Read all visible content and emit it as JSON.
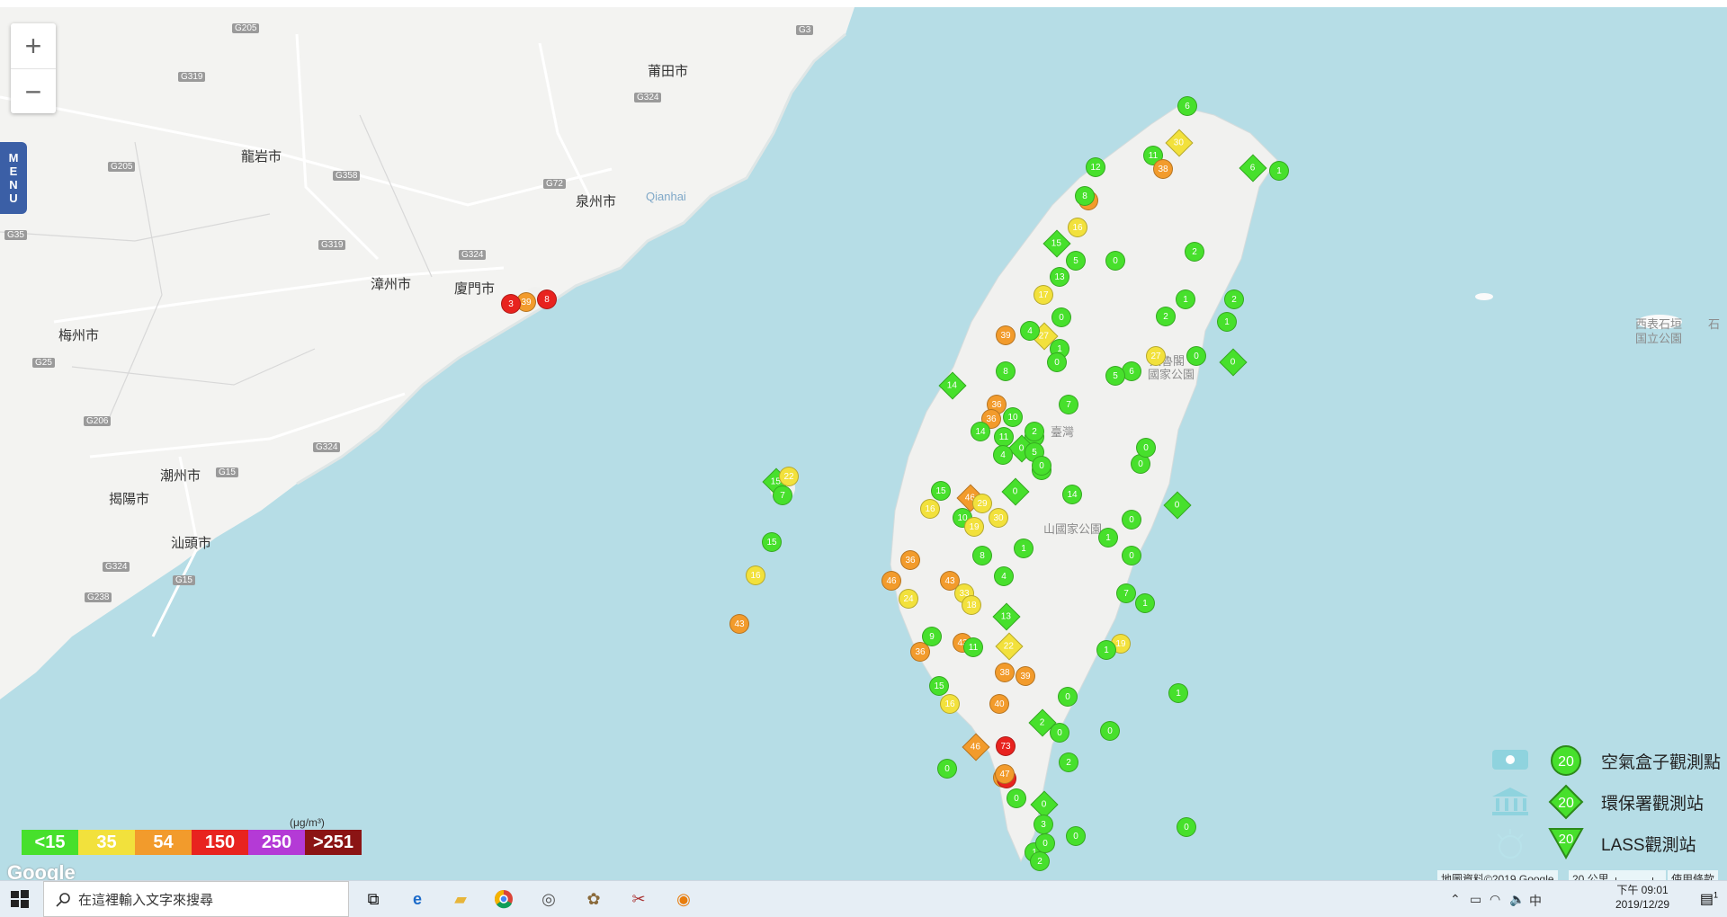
{
  "map": {
    "zoom_in": "+",
    "zoom_out": "−",
    "menu_label": [
      "M",
      "E",
      "N",
      "U"
    ],
    "google_logo": "Google",
    "copyright": "地圖資料©2019 Google",
    "scale_text": "20 公里",
    "terms": "使用條款",
    "unit": "(μg/m³)",
    "place_labels": [
      {
        "text": "莆田市"
      },
      {
        "text": "龍岩市"
      },
      {
        "text": "泉州市"
      },
      {
        "text": "Qianhai"
      },
      {
        "text": "漳州市"
      },
      {
        "text": "廈門市"
      },
      {
        "text": "梅州市"
      },
      {
        "text": "潮州市"
      },
      {
        "text": "揭陽市"
      },
      {
        "text": "汕頭市"
      },
      {
        "text": "太魯閣"
      },
      {
        "text": "國家公園"
      },
      {
        "text": "山國家公園"
      },
      {
        "text": "臺灣"
      },
      {
        "text": "西表石垣"
      },
      {
        "text": "国立公園"
      },
      {
        "text": "石"
      }
    ],
    "road_labels": [
      "G205",
      "G3",
      "G319",
      "G324",
      "G205",
      "G358",
      "G72",
      "G319",
      "G324",
      "G35",
      "G25",
      "G206",
      "G15",
      "G324",
      "G15",
      "G238",
      "G324"
    ]
  },
  "pm25_scale": [
    {
      "label": "<15",
      "color": "#47e02c"
    },
    {
      "label": "35",
      "color": "#f2e13c"
    },
    {
      "label": "54",
      "color": "#f29b2c"
    },
    {
      "label": "150",
      "color": "#e8231f"
    },
    {
      "label": "250",
      "color": "#b43ad6"
    },
    {
      "label": ">251",
      "color": "#8b1414"
    }
  ],
  "symbol_legend": [
    {
      "icon": "airbox-icon",
      "value": "20",
      "label": "空氣盒子觀測點"
    },
    {
      "icon": "epa-building-icon",
      "value": "20",
      "label": "環保署觀測站"
    },
    {
      "icon": "lass-icon",
      "value": "20",
      "label": "LASS觀測站"
    }
  ],
  "markers": [
    {
      "v": "39",
      "c": "#f29b2c"
    },
    {
      "v": "3",
      "c": "#e8231f"
    },
    {
      "v": "8",
      "c": "#e8231f"
    },
    {
      "v": "15",
      "c": "#47e02c"
    },
    {
      "v": "22",
      "c": "#f2e13c"
    },
    {
      "v": "7",
      "c": "#47e02c"
    },
    {
      "v": "15",
      "c": "#47e02c"
    },
    {
      "v": "16",
      "c": "#f2e13c"
    },
    {
      "v": "43",
      "c": "#f29b2c"
    },
    {
      "v": "6",
      "c": "#47e02c"
    },
    {
      "v": "30",
      "c": "#f2e13c"
    },
    {
      "v": "11",
      "c": "#47e02c"
    },
    {
      "v": "12",
      "c": "#47e02c"
    },
    {
      "v": "38",
      "c": "#f29b2c"
    },
    {
      "v": "37",
      "c": "#f29b2c"
    },
    {
      "v": "1",
      "c": "#47e02c"
    },
    {
      "v": "8",
      "c": "#47e02c"
    },
    {
      "v": "15",
      "c": "#47e02c"
    },
    {
      "v": "16",
      "c": "#f2e13c"
    },
    {
      "v": "0",
      "c": "#47e02c"
    },
    {
      "v": "2",
      "c": "#47e02c"
    },
    {
      "v": "5",
      "c": "#47e02c"
    },
    {
      "v": "13",
      "c": "#47e02c"
    },
    {
      "v": "17",
      "c": "#f2e13c"
    },
    {
      "v": "27",
      "c": "#f2e13c"
    },
    {
      "v": "0",
      "c": "#47e02c"
    },
    {
      "v": "1",
      "c": "#47e02c"
    },
    {
      "v": "39",
      "c": "#f29b2c"
    },
    {
      "v": "8",
      "c": "#47e02c"
    },
    {
      "v": "4",
      "c": "#47e02c"
    },
    {
      "v": "0",
      "c": "#47e02c"
    },
    {
      "v": "14",
      "c": "#47e02c"
    },
    {
      "v": "36",
      "c": "#f29b2c"
    },
    {
      "v": "36",
      "c": "#f29b2c"
    },
    {
      "v": "10",
      "c": "#47e02c"
    },
    {
      "v": "11",
      "c": "#47e02c"
    },
    {
      "v": "5",
      "c": "#47e02c"
    },
    {
      "v": "2",
      "c": "#47e02c"
    },
    {
      "v": "0",
      "c": "#47e02c"
    },
    {
      "v": "7",
      "c": "#47e02c"
    },
    {
      "v": "5",
      "c": "#47e02c"
    },
    {
      "v": "1",
      "c": "#47e02c"
    },
    {
      "v": "14",
      "c": "#47e02c"
    },
    {
      "v": "4",
      "c": "#47e02c"
    },
    {
      "v": "0",
      "c": "#47e02c"
    },
    {
      "v": "46",
      "c": "#f29b2c"
    },
    {
      "v": "29",
      "c": "#f2e13c"
    },
    {
      "v": "30",
      "c": "#f2e13c"
    },
    {
      "v": "15",
      "c": "#47e02c"
    },
    {
      "v": "10",
      "c": "#47e02c"
    },
    {
      "v": "16",
      "c": "#f2e13c"
    },
    {
      "v": "19",
      "c": "#f2e13c"
    },
    {
      "v": "0",
      "c": "#47e02c"
    },
    {
      "v": "46",
      "c": "#f29b2c"
    },
    {
      "v": "36",
      "c": "#f29b2c"
    },
    {
      "v": "24",
      "c": "#f2e13c"
    },
    {
      "v": "43",
      "c": "#f29b2c"
    },
    {
      "v": "33",
      "c": "#f2e13c"
    },
    {
      "v": "18",
      "c": "#f2e13c"
    },
    {
      "v": "13",
      "c": "#47e02c"
    },
    {
      "v": "1",
      "c": "#47e02c"
    },
    {
      "v": "4",
      "c": "#47e02c"
    },
    {
      "v": "8",
      "c": "#47e02c"
    },
    {
      "v": "36",
      "c": "#f29b2c"
    },
    {
      "v": "43",
      "c": "#f29b2c"
    },
    {
      "v": "11",
      "c": "#47e02c"
    },
    {
      "v": "22",
      "c": "#f2e13c"
    },
    {
      "v": "9",
      "c": "#47e02c"
    },
    {
      "v": "39",
      "c": "#f29b2c"
    },
    {
      "v": "38",
      "c": "#f29b2c"
    },
    {
      "v": "40",
      "c": "#f29b2c"
    },
    {
      "v": "15",
      "c": "#47e02c"
    },
    {
      "v": "16",
      "c": "#f2e13c"
    },
    {
      "v": "46",
      "c": "#f29b2c"
    },
    {
      "v": "73",
      "c": "#e8231f"
    },
    {
      "v": "37",
      "c": "#f29b2c"
    },
    {
      "v": "89",
      "c": "#e8231f"
    },
    {
      "v": "47",
      "c": "#f29b2c"
    },
    {
      "v": "0",
      "c": "#47e02c"
    },
    {
      "v": "0",
      "c": "#47e02c"
    },
    {
      "v": "0",
      "c": "#47e02c"
    },
    {
      "v": "3",
      "c": "#47e02c"
    },
    {
      "v": "1",
      "c": "#47e02c"
    },
    {
      "v": "2",
      "c": "#47e02c"
    },
    {
      "v": "0",
      "c": "#47e02c"
    },
    {
      "v": "0",
      "c": "#47e02c"
    },
    {
      "v": "2",
      "c": "#47e02c"
    },
    {
      "v": "2",
      "c": "#47e02c"
    },
    {
      "v": "0",
      "c": "#47e02c"
    },
    {
      "v": "0",
      "c": "#47e02c"
    },
    {
      "v": "19",
      "c": "#f2e13c"
    },
    {
      "v": "0",
      "c": "#47e02c"
    },
    {
      "v": "1",
      "c": "#47e02c"
    },
    {
      "v": "14",
      "c": "#47e02c"
    },
    {
      "v": "0",
      "c": "#47e02c"
    },
    {
      "v": "0",
      "c": "#47e02c"
    },
    {
      "v": "7",
      "c": "#47e02c"
    },
    {
      "v": "0",
      "c": "#47e02c"
    },
    {
      "v": "0",
      "c": "#47e02c"
    },
    {
      "v": "27",
      "c": "#f2e13c"
    },
    {
      "v": "1",
      "c": "#47e02c"
    },
    {
      "v": "0",
      "c": "#47e02c"
    },
    {
      "v": "2",
      "c": "#47e02c"
    },
    {
      "v": "6",
      "c": "#47e02c"
    },
    {
      "v": "5",
      "c": "#47e02c"
    },
    {
      "v": "1",
      "c": "#47e02c"
    },
    {
      "v": "0",
      "c": "#47e02c"
    },
    {
      "v": "2",
      "c": "#47e02c"
    },
    {
      "v": "6",
      "c": "#47e02c"
    },
    {
      "v": "1",
      "c": "#47e02c"
    },
    {
      "v": "0",
      "c": "#47e02c"
    },
    {
      "v": "1",
      "c": "#47e02c"
    },
    {
      "v": "0",
      "c": "#47e02c"
    },
    {
      "v": "1",
      "c": "#47e02c"
    }
  ],
  "taskbar": {
    "search_placeholder": "在這裡輸入文字來搜尋",
    "time": "下午 09:01",
    "date": "2019/12/29",
    "ime": "中",
    "notification_count": "1"
  }
}
